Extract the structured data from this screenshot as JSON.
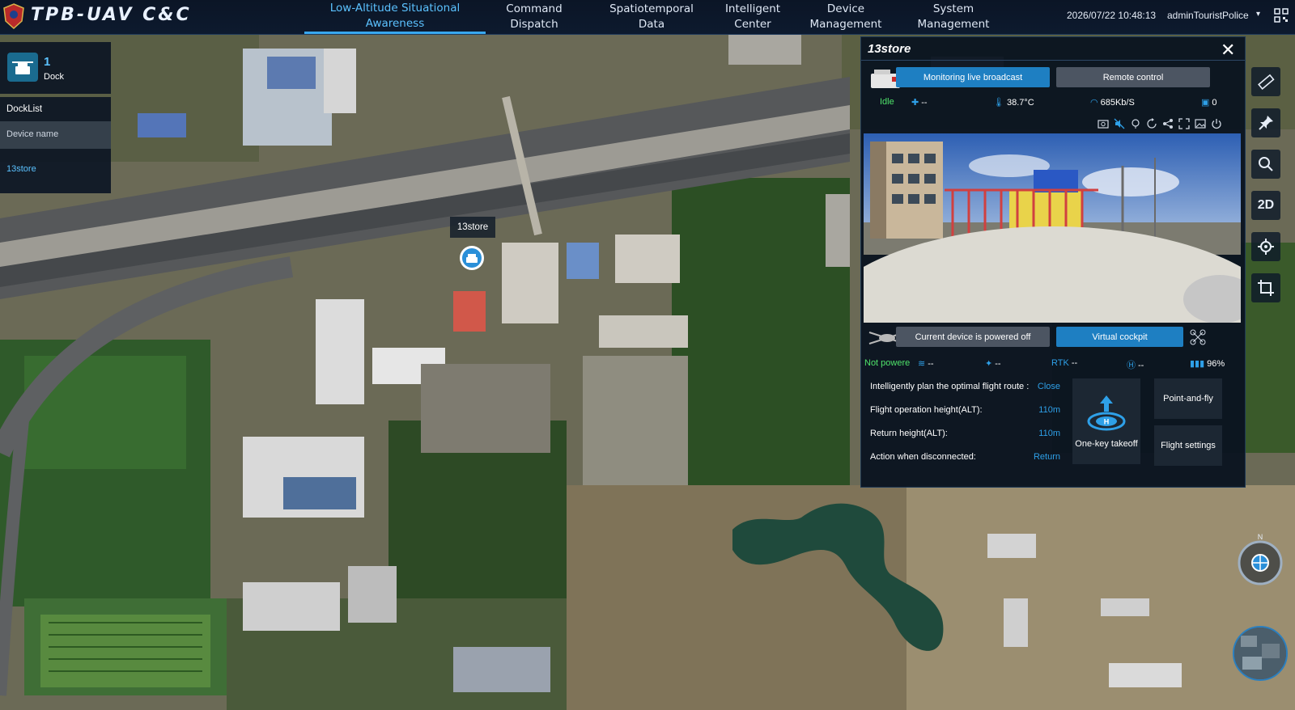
{
  "app": {
    "title": "TPB-UAV C&C"
  },
  "nav": {
    "items": [
      {
        "label_1": "Low-Altitude Situational",
        "label_2": "Awareness"
      },
      {
        "label_1": "Command",
        "label_2": "Dispatch"
      },
      {
        "label_1": "Spatiotemporal",
        "label_2": "Data"
      },
      {
        "label_1": "Intelligent",
        "label_2": "Center"
      },
      {
        "label_1": "Device",
        "label_2": "Management"
      },
      {
        "label_1": "System",
        "label_2": "Management"
      }
    ],
    "active_index": 0
  },
  "header": {
    "datetime": "2026/07/22 10:48:13",
    "user": "adminTouristPolice",
    "caret": "▾"
  },
  "dock_summary": {
    "count": "1",
    "label": "Dock"
  },
  "dock_list": {
    "title": "DockList",
    "column_header": "Device name",
    "rows": [
      "13store"
    ]
  },
  "map": {
    "marker_label": "13store",
    "compass_n": "N"
  },
  "tools": [
    "ruler-icon",
    "pin-icon",
    "search-icon",
    "2D",
    "locate-icon",
    "crop-icon"
  ],
  "panel": {
    "title": "13store",
    "close": "✕",
    "dock": {
      "btn_live": "Monitoring live broadcast",
      "btn_remote": "Remote control",
      "status": "Idle",
      "link": "--",
      "temperature": "38.7°C",
      "network": "685Kb/S",
      "storage": "0"
    },
    "drone": {
      "power_btn": "Current device is powered off",
      "cockpit_btn": "Virtual cockpit",
      "status": "Not powere",
      "wind": "--",
      "satellite": "--",
      "rtk_label": "RTK",
      "rtk": "--",
      "h": "--",
      "battery": "96%"
    },
    "form": {
      "route_label": "Intelligently plan the optimal flight route :",
      "route_value": "Close",
      "alt_label": "Flight operation height(ALT):",
      "alt_value": "110m",
      "return_label": "Return height(ALT):",
      "return_value": "110m",
      "disconnect_label": "Action when disconnected:",
      "disconnect_value": "Return"
    },
    "actions": {
      "takeoff": "One-key takeoff",
      "point_fly": "Point-and-fly",
      "flight_settings": "Flight settings"
    }
  },
  "colors": {
    "accent": "#1e7fc2",
    "active_nav": "#5bc2ff",
    "status_green": "#4fe36a",
    "panel_bg": "#0a1420"
  }
}
